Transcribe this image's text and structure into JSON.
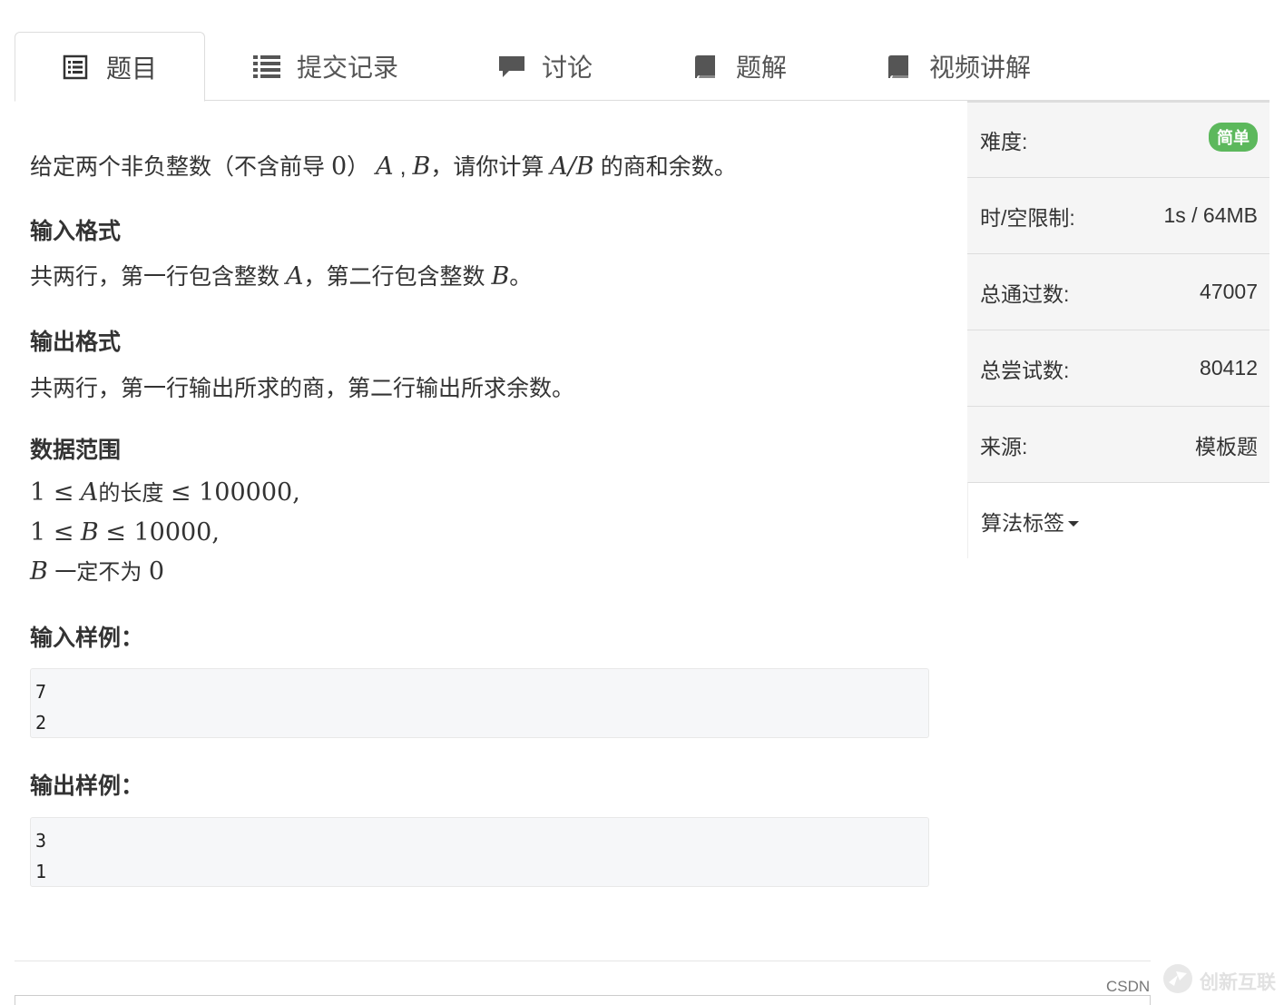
{
  "tabs": [
    {
      "label": "题目",
      "icon": "list-alt-icon",
      "active": true
    },
    {
      "label": "提交记录",
      "icon": "list-icon",
      "active": false
    },
    {
      "label": "讨论",
      "icon": "comment-icon",
      "active": false
    },
    {
      "label": "题解",
      "icon": "book-icon",
      "active": false
    },
    {
      "label": "视频讲解",
      "icon": "book-icon",
      "active": false
    }
  ],
  "problem": {
    "desc_pre": "给定两个非负整数（不含前导",
    "desc_zero": "0",
    "desc_close": "）",
    "var_a": "A",
    "comma": ",",
    "var_b": "B",
    "desc_mid": "，请你计算",
    "expr": "A/B",
    "desc_post": "的商和余数。",
    "input_heading": "输入格式",
    "input_pre": "共两行，第一行包含整数",
    "input_mid": "，第二行包含整数",
    "input_end": "。",
    "output_heading": "输出格式",
    "output_text": "共两行，第一行输出所求的商，第二行输出所求余数。",
    "range_heading": "数据范围",
    "range_line1_pre": "1 ≤",
    "range_line1_var": "A",
    "range_line1_cn": "的长度",
    "range_line1_post": "≤ 100000,",
    "range_line2_pre": "1 ≤",
    "range_line2_var": "B",
    "range_line2_post": "≤ 10000,",
    "range_line3_var": "B",
    "range_line3_cn": "一定不为",
    "range_line3_num": "0",
    "sample_input_heading": "输入样例：",
    "sample_input": [
      "7",
      "2"
    ],
    "sample_output_heading": "输出样例：",
    "sample_output": [
      "3",
      "1"
    ]
  },
  "sidebar": {
    "difficulty_label": "难度:",
    "difficulty_value": "简单",
    "limit_label": "时/空限制:",
    "limit_value": "1s / 64MB",
    "passed_label": "总通过数:",
    "passed_value": "47007",
    "tried_label": "总尝试数:",
    "tried_value": "80412",
    "source_label": "来源:",
    "source_value": "模板题",
    "tags_label": "算法标签"
  },
  "footer": {
    "csdn": "CSDN",
    "watermark": "创新互联"
  },
  "colors": {
    "accent_green": "#5cb85c",
    "border": "#dddddd",
    "sidebar_bg": "#f5f5f5",
    "code_bg": "#f6f7f9"
  }
}
